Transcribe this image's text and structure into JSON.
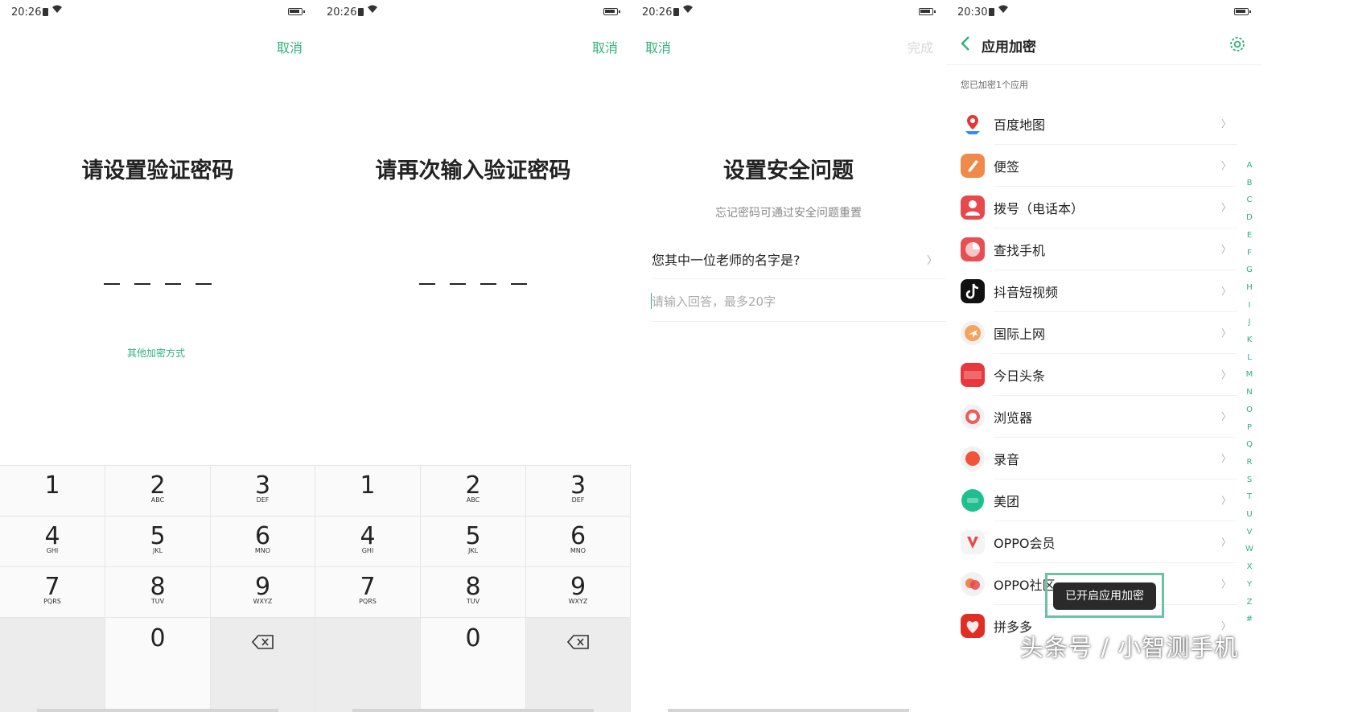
{
  "panel1": {
    "status": {
      "time": "20:26"
    },
    "cancel": "取消",
    "title": "请设置验证密码",
    "other_method": "其他加密方式"
  },
  "panel2": {
    "status": {
      "time": "20:26"
    },
    "cancel": "取消",
    "title": "请再次输入验证密码"
  },
  "keypad": {
    "keys": [
      {
        "digit": "1",
        "letters": ""
      },
      {
        "digit": "2",
        "letters": "ABC"
      },
      {
        "digit": "3",
        "letters": "DEF"
      },
      {
        "digit": "4",
        "letters": "GHI"
      },
      {
        "digit": "5",
        "letters": "JKL"
      },
      {
        "digit": "6",
        "letters": "MNO"
      },
      {
        "digit": "7",
        "letters": "PQRS"
      },
      {
        "digit": "8",
        "letters": "TUV"
      },
      {
        "digit": "9",
        "letters": "WXYZ"
      },
      {
        "digit": "0",
        "letters": ""
      }
    ]
  },
  "panel3": {
    "status": {
      "time": "20:26"
    },
    "cancel": "取消",
    "done": "完成",
    "title": "设置安全问题",
    "subtitle": "忘记密码可通过安全问题重置",
    "question": "您其中一位老师的名字是?",
    "answer_placeholder": "请输入回答，最多20字"
  },
  "panel4": {
    "status": {
      "time": "20:30"
    },
    "header_title": "应用加密",
    "count_text": "您已加密1个应用",
    "apps": [
      {
        "name": "百度地图",
        "icon": "baidu-map-icon",
        "color": "#ffffff"
      },
      {
        "name": "便签",
        "icon": "notes-icon",
        "color": "#f08a4b"
      },
      {
        "name": "拨号（电话本）",
        "icon": "phone-contact-icon",
        "color": "#e8474b"
      },
      {
        "name": "查找手机",
        "icon": "find-phone-icon",
        "color": "#e84f52"
      },
      {
        "name": "抖音短视频",
        "icon": "douyin-icon",
        "color": "#111111"
      },
      {
        "name": "国际上网",
        "icon": "airplane-icon",
        "color": "#f5a25d"
      },
      {
        "name": "今日头条",
        "icon": "toutiao-icon",
        "color": "#e8383d"
      },
      {
        "name": "浏览器",
        "icon": "browser-icon",
        "color": "#f05a5a"
      },
      {
        "name": "录音",
        "icon": "recorder-icon",
        "color": "#f0533a"
      },
      {
        "name": "美团",
        "icon": "meituan-icon",
        "color": "#1fbf8f"
      },
      {
        "name": "OPPO会员",
        "icon": "oppo-member-icon",
        "color": "#e8484d"
      },
      {
        "name": "OPPO社区",
        "icon": "oppo-community-icon",
        "color": "#f0834b"
      },
      {
        "name": "拼多多",
        "icon": "pinduoduo-icon",
        "color": "#e02e24"
      }
    ],
    "alphabet": [
      "A",
      "B",
      "C",
      "D",
      "E",
      "F",
      "G",
      "H",
      "I",
      "J",
      "K",
      "L",
      "M",
      "N",
      "O",
      "P",
      "Q",
      "R",
      "S",
      "T",
      "U",
      "V",
      "W",
      "X",
      "Y",
      "Z",
      "#"
    ],
    "toast": "已开启应用加密"
  },
  "watermark": "头条号 / 小智测手机",
  "colors": {
    "accent": "#2fb17a"
  }
}
